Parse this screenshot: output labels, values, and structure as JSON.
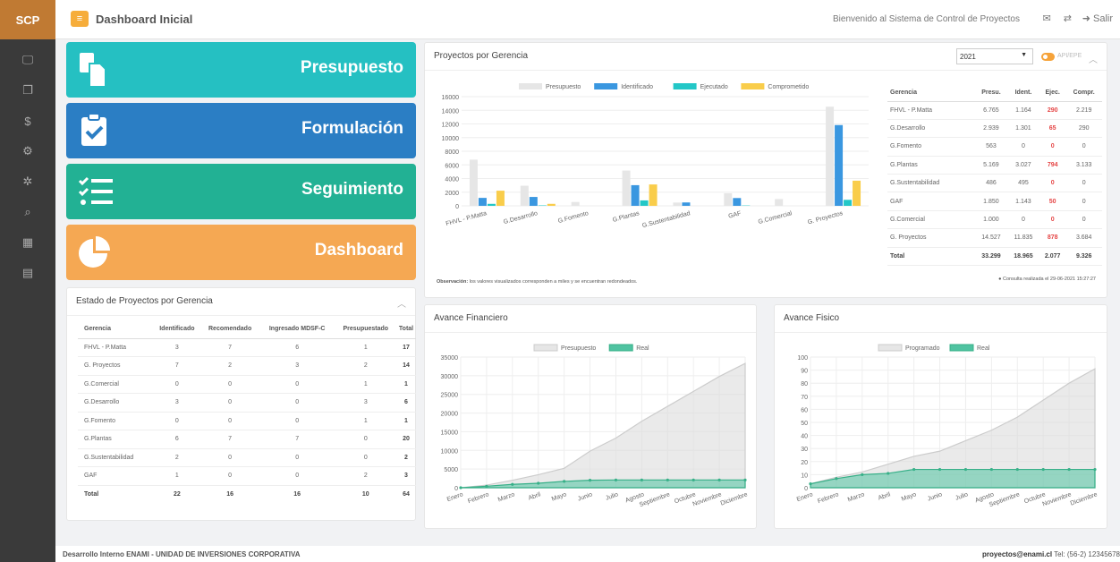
{
  "brand": "SCP",
  "header": {
    "title": "Dashboard Inicial",
    "welcome": "Bienvenido al Sistema de Control de Proyectos",
    "logout": "Salir"
  },
  "tiles": {
    "presupuesto": "Presupuesto",
    "formulacion": "Formulación",
    "seguimiento": "Seguimiento",
    "dashboard": "Dashboard"
  },
  "estado": {
    "title": "Estado de Proyectos por Gerencia",
    "headers": [
      "Gerencia",
      "Identificado",
      "Recomendado",
      "Ingresado MDSF-C",
      "Presupuestado",
      "Total"
    ],
    "rows": [
      [
        "FHVL - P.Matta",
        "3",
        "7",
        "6",
        "1",
        "17"
      ],
      [
        "G. Proyectos",
        "7",
        "2",
        "3",
        "2",
        "14"
      ],
      [
        "G.Comercial",
        "0",
        "0",
        "0",
        "1",
        "1"
      ],
      [
        "G.Desarrollo",
        "3",
        "0",
        "0",
        "3",
        "6"
      ],
      [
        "G.Fomento",
        "0",
        "0",
        "0",
        "1",
        "1"
      ],
      [
        "G.Plantas",
        "6",
        "7",
        "7",
        "0",
        "20"
      ],
      [
        "G.Sustentabilidad",
        "2",
        "0",
        "0",
        "0",
        "2"
      ],
      [
        "GAF",
        "1",
        "0",
        "0",
        "2",
        "3"
      ]
    ],
    "total": [
      "Total",
      "22",
      "16",
      "16",
      "10",
      "64"
    ]
  },
  "proyectos": {
    "title": "Proyectos por Gerencia",
    "year": "2021",
    "toggle_label": "API/EPE",
    "note_label": "Observación:",
    "note": "los valores visualizados corresponden a miles y se encuentran redondeados.",
    "consulta": "Consulta realizada el 29-06-2021 15:27:27",
    "headers": [
      "Gerencia",
      "Presu.",
      "Ident.",
      "Ejec.",
      "Compr."
    ],
    "rows": [
      [
        "FHVL - P.Matta",
        "6.765",
        "1.164",
        "290",
        "2.219"
      ],
      [
        "G.Desarrollo",
        "2.939",
        "1.301",
        "65",
        "290"
      ],
      [
        "G.Fomento",
        "563",
        "0",
        "0",
        "0"
      ],
      [
        "G.Plantas",
        "5.169",
        "3.027",
        "794",
        "3.133"
      ],
      [
        "G.Sustentabilidad",
        "486",
        "495",
        "0",
        "0"
      ],
      [
        "GAF",
        "1.850",
        "1.143",
        "50",
        "0"
      ],
      [
        "G.Comercial",
        "1.000",
        "0",
        "0",
        "0"
      ],
      [
        "G. Proyectos",
        "14.527",
        "11.835",
        "878",
        "3.684"
      ]
    ],
    "total": [
      "Total",
      "33.299",
      "18.965",
      "2.077",
      "9.326"
    ]
  },
  "avance_financiero": {
    "title": "Avance Financiero"
  },
  "avance_fisico": {
    "title": "Avance Fisico"
  },
  "footer": {
    "left": "Desarrollo Interno ENAMI - UNIDAD DE INVERSIONES CORPORATIVA",
    "email": "proyectos@enami.cl",
    "tel": "Tel: (56-2) 12345678"
  },
  "colors": {
    "presupuesto": "#e6e6e6",
    "identificado": "#3a97e0",
    "ejecutado": "#23c7c7",
    "comprometido": "#f9cd4b",
    "real": "#4fc3a1"
  },
  "chart_data": [
    {
      "type": "bar",
      "categories": [
        "FHVL - P.Matta",
        "G.Desarrollo",
        "G.Fomento",
        "G.Plantas",
        "G.Sustentabilidad",
        "GAF",
        "G.Comercial",
        "G. Proyectos"
      ],
      "series": [
        {
          "name": "Presupuesto",
          "values": [
            6765,
            2939,
            563,
            5169,
            486,
            1850,
            1000,
            14527
          ]
        },
        {
          "name": "Identificado",
          "values": [
            1164,
            1301,
            0,
            3027,
            495,
            1143,
            0,
            11835
          ]
        },
        {
          "name": "Ejecutado",
          "values": [
            290,
            65,
            0,
            794,
            0,
            50,
            0,
            878
          ]
        },
        {
          "name": "Comprometido",
          "values": [
            2219,
            290,
            0,
            3133,
            0,
            0,
            0,
            3684
          ]
        }
      ],
      "ylim": [
        0,
        16000
      ],
      "yticks": [
        0,
        2000,
        4000,
        6000,
        8000,
        10000,
        12000,
        14000,
        16000
      ],
      "legend": "top"
    },
    {
      "type": "area",
      "categories": [
        "Enero",
        "Febrero",
        "Marzo",
        "Abril",
        "Mayo",
        "Junio",
        "Julio",
        "Agosto",
        "Septiembre",
        "Octubre",
        "Noviembre",
        "Diciembre"
      ],
      "series": [
        {
          "name": "Presupuesto",
          "values": [
            0,
            700,
            2000,
            3500,
            5200,
            9800,
            13300,
            17800,
            21800,
            25800,
            29800,
            33299
          ]
        },
        {
          "name": "Real",
          "values": [
            0,
            400,
            900,
            1200,
            1700,
            2000,
            2077,
            2077,
            2077,
            2077,
            2077,
            2077
          ]
        }
      ],
      "ylim": [
        0,
        35000
      ],
      "yticks": [
        0,
        5000,
        10000,
        15000,
        20000,
        25000,
        30000,
        35000
      ],
      "legend": "top"
    },
    {
      "type": "area",
      "categories": [
        "Enero",
        "Febrero",
        "Marzo",
        "Abril",
        "Mayo",
        "Junio",
        "Julio",
        "Agosto",
        "Septiembre",
        "Octubre",
        "Noviembre",
        "Diciembre"
      ],
      "series": [
        {
          "name": "Programado",
          "values": [
            3,
            8,
            12,
            18,
            24,
            28,
            36,
            44,
            54,
            67,
            80,
            91
          ]
        },
        {
          "name": "Real",
          "values": [
            3,
            7,
            10,
            11,
            14,
            14,
            14,
            14,
            14,
            14,
            14,
            14
          ]
        }
      ],
      "ylim": [
        0,
        100
      ],
      "yticks": [
        0,
        10,
        20,
        30,
        40,
        50,
        60,
        70,
        80,
        90,
        100
      ],
      "legend": "top"
    }
  ]
}
